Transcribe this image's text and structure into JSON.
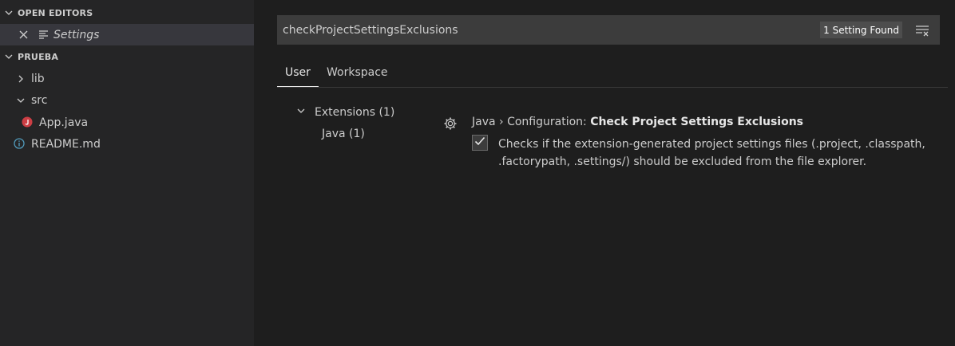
{
  "explorer": {
    "open_editors": {
      "header": "OPEN EDITORS",
      "items": [
        {
          "label": "Settings",
          "icon": "settings-file-icon"
        }
      ]
    },
    "workspace": {
      "header": "PRUEBA",
      "items": [
        {
          "label": "lib",
          "type": "folder",
          "expanded": false
        },
        {
          "label": "src",
          "type": "folder",
          "expanded": true
        },
        {
          "label": "App.java",
          "type": "file",
          "icon": "java-icon"
        },
        {
          "label": "README.md",
          "type": "file",
          "icon": "info-icon"
        }
      ]
    }
  },
  "settings": {
    "search_query": "checkProjectSettingsExclusions",
    "result_count": "1 Setting Found",
    "tabs": [
      {
        "label": "User",
        "active": true
      },
      {
        "label": "Workspace",
        "active": false
      }
    ],
    "toc": {
      "group": "Extensions (1)",
      "child": "Java (1)"
    },
    "setting": {
      "category": "Java › Configuration: ",
      "name": "Check Project Settings Exclusions",
      "checked": true,
      "description": "Checks if the extension-generated project settings files (.project, .classpath, .factorypath, .settings/) should be excluded from the file explorer."
    }
  },
  "colors": {
    "sidebar_bg": "#252526",
    "editor_bg": "#1e1e1e",
    "selected_row": "#37373d",
    "java_icon": "#cc3e44",
    "info_icon": "#519aba"
  }
}
